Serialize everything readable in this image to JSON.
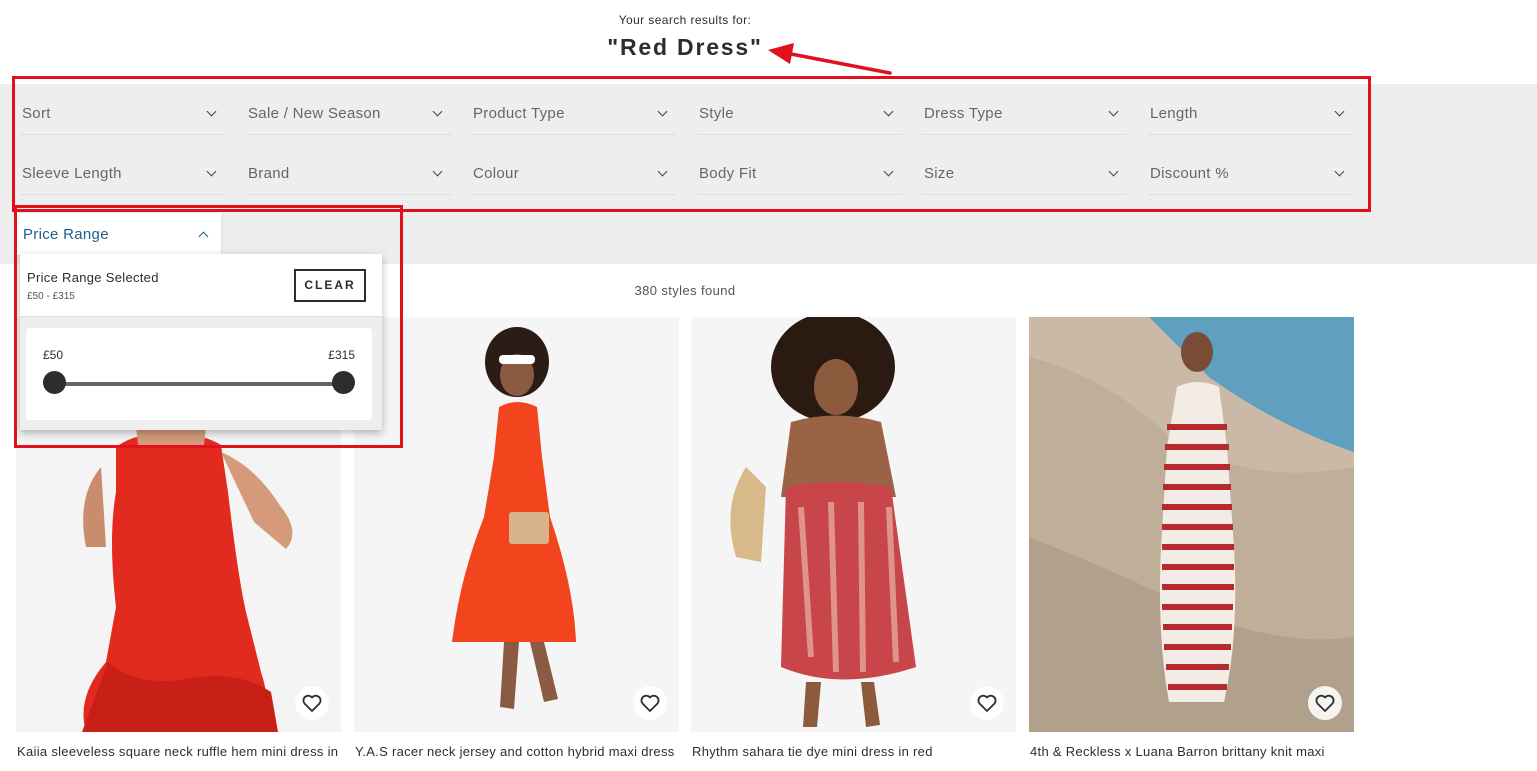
{
  "search": {
    "prefix": "Your search results for:",
    "query": "\"Red Dress\""
  },
  "filters": [
    {
      "label": "Sort"
    },
    {
      "label": "Sale / New Season"
    },
    {
      "label": "Product Type"
    },
    {
      "label": "Style"
    },
    {
      "label": "Dress Type"
    },
    {
      "label": "Length"
    },
    {
      "label": "Sleeve Length"
    },
    {
      "label": "Brand"
    },
    {
      "label": "Colour"
    },
    {
      "label": "Body Fit"
    },
    {
      "label": "Size"
    },
    {
      "label": "Discount %"
    }
  ],
  "price_filter": {
    "label": "Price Range",
    "expanded": true,
    "panel_title": "Price Range Selected",
    "selected_range": "£50 - £315",
    "clear_label": "CLEAR",
    "min_label": "£50",
    "max_label": "£315",
    "handle_min_fraction": 0.0,
    "handle_max_fraction": 1.0
  },
  "results": {
    "count_text": "380 styles found"
  },
  "products": [
    {
      "title": "Kaiia sleeveless square neck ruffle hem mini dress in",
      "image": "red ruffle-hem mini dress"
    },
    {
      "title": "Y.A.S racer neck jersey and cotton hybrid maxi dress",
      "image": "orange-red maxi dress"
    },
    {
      "title": "Rhythm sahara tie dye mini dress in red",
      "image": "red tie dye mini dress"
    },
    {
      "title": "4th & Reckless x Luana Barron brittany knit maxi",
      "image": "red and white striped knit maxi dress"
    }
  ],
  "colors": {
    "annotation": "#e0101c",
    "filter_band": "#eeeeee",
    "accent_link": "#1f5f8b",
    "text": "#2d2d2d"
  }
}
